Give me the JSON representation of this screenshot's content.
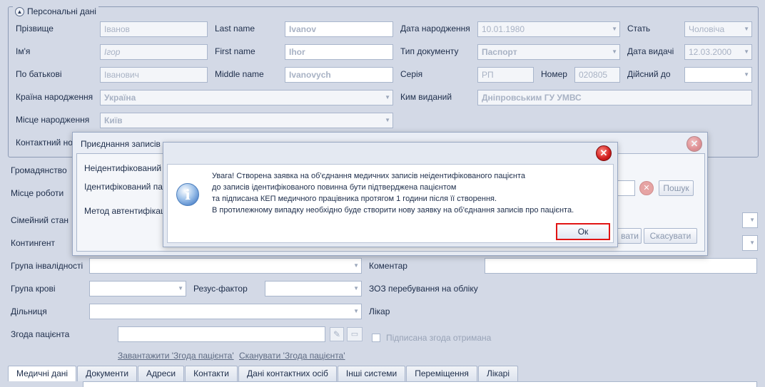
{
  "personal": {
    "group_title": "Персональні дані",
    "surname_label": "Прізвище",
    "surname_value": "Іванов",
    "lastname_label": "Last name",
    "lastname_value": "Ivanov",
    "dob_label": "Дата народження",
    "dob_value": "10.01.1980",
    "sex_label": "Стать",
    "sex_value": "Чоловіча",
    "name_label": "Ім'я",
    "name_value": "Ігор",
    "firstname_label": "First name",
    "firstname_value": "Ihor",
    "doctype_label": "Тип документу",
    "doctype_value": "Паспорт",
    "issue_date_label": "Дата видачі",
    "issue_date_value": "12.03.2000",
    "patronymic_label": "По батькові",
    "patronymic_value": "Іванович",
    "middlename_label": "Middle name",
    "middlename_value": "Ivanovych",
    "series_label": "Серія",
    "series_value": "РП",
    "number_label": "Номер",
    "number_value": "020805",
    "valid_until_label": "Дійсний до",
    "birth_country_label": "Країна народження",
    "birth_country_value": "Україна",
    "issued_by_label": "Ким виданий",
    "issued_by_value": "Дніпровським ГУ УМВС",
    "birth_place_label": "Місце народження",
    "birth_place_value": "Київ",
    "contact_label": "Контактний но"
  },
  "lower": {
    "citizenship_label": "Громадянство",
    "workplace_label": "Місце роботи",
    "marital_label": "Сімейний стан",
    "contingent_label": "Контингент",
    "disability_label": "Група інвалідності",
    "comment_label": "Коментар",
    "blood_label": "Група крові",
    "rh_label": "Резус-фактор",
    "zoz_label": "ЗОЗ перебування на обліку",
    "district_label": "Дільниця",
    "doctor_label": "Лікар",
    "consent_label": "Згода пацієнта",
    "signed_consent_label": "Підписана згода отримана",
    "upload_link": "Завантажити 'Згода пацієнта'",
    "scan_link": "Сканувати 'Згода пацієнта'"
  },
  "tabs": [
    "Медичні дані",
    "Документи",
    "Адреси",
    "Контакти",
    "Дані контактних осіб",
    "Інші системи",
    "Переміщення",
    "Лікарі"
  ],
  "merge_dialog": {
    "title": "Приєднання записів н",
    "unidentified_label": "Неідентифікований",
    "identified_label": "Ідентифікований па",
    "auth_method_label": "Метод автентифікаці",
    "search_button": "Пошук",
    "confirm_button": "вати",
    "cancel_button": "Скасувати"
  },
  "message_box": {
    "lines": [
      "Увага! Створена заявка на об'єднання медичних записів неідентифікованого пацієнта",
      "до записів ідентифікованого повинна бути підтверджена пацієнтом",
      "та підписана КЕП медичного працівника протягом 1 години після її створення.",
      "В протилежному випадку необхідно буде створити нову заявку на об'єднання записів про пацієнта."
    ],
    "ok_button": "Ок"
  }
}
